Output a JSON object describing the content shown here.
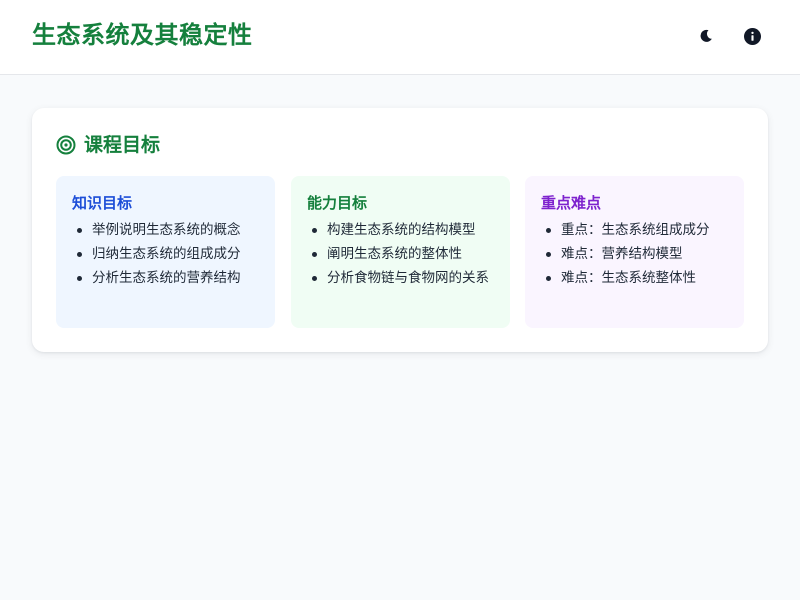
{
  "header": {
    "title": "生态系统及其稳定性",
    "theme_icon": "moon-icon",
    "info_icon": "info-icon"
  },
  "course_goals": {
    "title": "课程目标",
    "icon": "target-icon",
    "sections": [
      {
        "title": "知识目标",
        "color": "#1d4ed8",
        "background": "#eff6ff",
        "items": [
          "举例说明生态系统的概念",
          "归纳生态系统的组成成分",
          "分析生态系统的营养结构"
        ]
      },
      {
        "title": "能力目标",
        "color": "#15803d",
        "background": "#f0fdf4",
        "items": [
          "构建生态系统的结构模型",
          "阐明生态系统的整体性",
          "分析食物链与食物网的关系"
        ]
      },
      {
        "title": "重点难点",
        "color": "#7e22ce",
        "background": "#faf5ff",
        "items": [
          "重点：生态系统组成成分",
          "难点：营养结构模型",
          "难点：生态系统整体性"
        ]
      }
    ]
  },
  "colors": {
    "accent": "#15803d",
    "page_background": "#f8fafc"
  }
}
